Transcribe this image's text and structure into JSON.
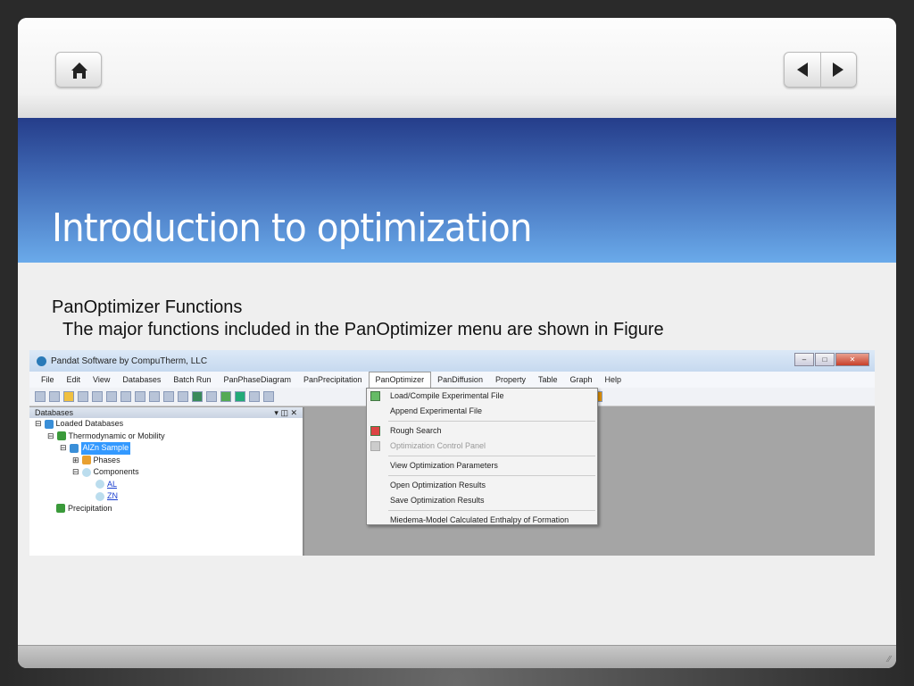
{
  "slide": {
    "title": "Introduction to optimization",
    "heading": "PanOptimizer Functions",
    "body": "The major functions included in the PanOptimizer menu are shown in Figure"
  },
  "nav": {
    "home_icon": "home-icon",
    "prev_icon": "triangle-left-icon",
    "next_icon": "triangle-right-icon"
  },
  "app": {
    "window_title": "Pandat Software by CompuTherm, LLC",
    "menu": [
      "File",
      "Edit",
      "View",
      "Databases",
      "Batch Run",
      "PanPhaseDiagram",
      "PanPrecipitation",
      "PanOptimizer",
      "PanDiffusion",
      "Property",
      "Table",
      "Graph",
      "Help"
    ],
    "panel_title": "Databases",
    "tree": [
      "Loaded Databases",
      "Thermodynamic or Mobility",
      "AlZn Sample",
      "Phases",
      "Components",
      "AL",
      "ZN",
      "Precipitation"
    ],
    "dropdown": [
      "Load/Compile Experimental File",
      "Append Experimental File",
      "Rough Search",
      "Optimization Control Panel",
      "View Optimization Parameters",
      "Open Optimization Results",
      "Save Optimization Results",
      "Miedema-Model Calculated Enthalpy of Formation"
    ]
  },
  "colors": {
    "band_top": "#253d8a",
    "band_bottom": "#6aaaea",
    "selection": "#3399ff"
  }
}
